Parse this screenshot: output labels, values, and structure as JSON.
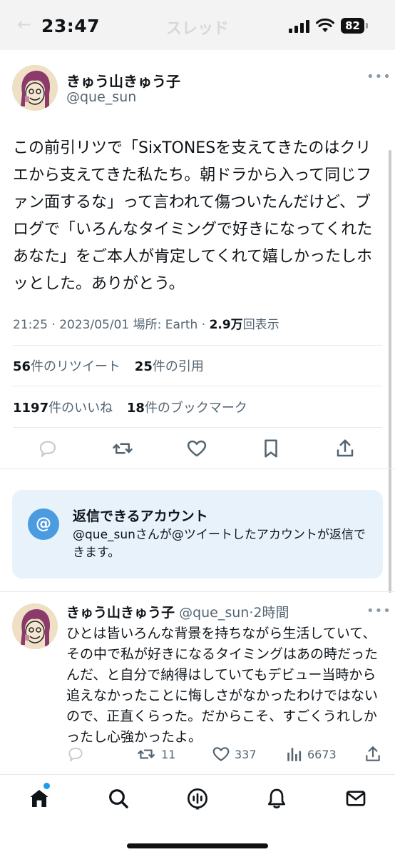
{
  "status_bar": {
    "time": "23:47",
    "battery": "82"
  },
  "header": {
    "title_faded": "スレッド"
  },
  "tweet": {
    "author_name": "きゅう山きゅう子",
    "author_handle": "@que_sun",
    "more_icon": "more-dots-icon",
    "text": "この前引リツで「SixTONESを支えてきたのはクリエから支えてきた私たち。朝ドラから入って同じファン面するな」って言われて傷ついたんだけど、ブログで「いろんなタイミングで好きになってくれたあなた」をご本人が肯定してくれて嬉しかったしホッとした。ありがとう。",
    "time": "21:25",
    "date": "2023/05/01",
    "location_label": "場所: Earth",
    "views_count": "2.9万",
    "views_label": "回表示",
    "retweets_count": "56",
    "retweets_label": "件のリツイート",
    "quotes_count": "25",
    "quotes_label": "件の引用",
    "likes_count": "1197",
    "likes_label": "件のいいね",
    "bookmarks_count": "18",
    "bookmarks_label": "件のブックマーク"
  },
  "reply_restriction": {
    "icon_glyph": "@",
    "title": "返信できるアカウント",
    "body": "@que_sunさんが@ツイートしたアカウントが返信できます。"
  },
  "reply": {
    "author_name": "きゅう山きゅう子",
    "author_handle": "@que_sun",
    "time_ago": "2時間",
    "text": "ひとは皆いろんな背景を持ちながら生活していて、その中で私が好きになるタイミングはあの時だったんだ、と自分で納得はしていてもデビュー当時から追えなかったことに悔しさがなかったわけではないので、正直くらった。だからこそ、すごくうれしかったし心強かったよ。",
    "retweets": "11",
    "likes": "337",
    "views": "6673"
  },
  "colors": {
    "accent": "#1d9bf0",
    "text_primary": "#0f1419",
    "text_secondary": "#536471",
    "card_background": "#e8f2fb"
  }
}
